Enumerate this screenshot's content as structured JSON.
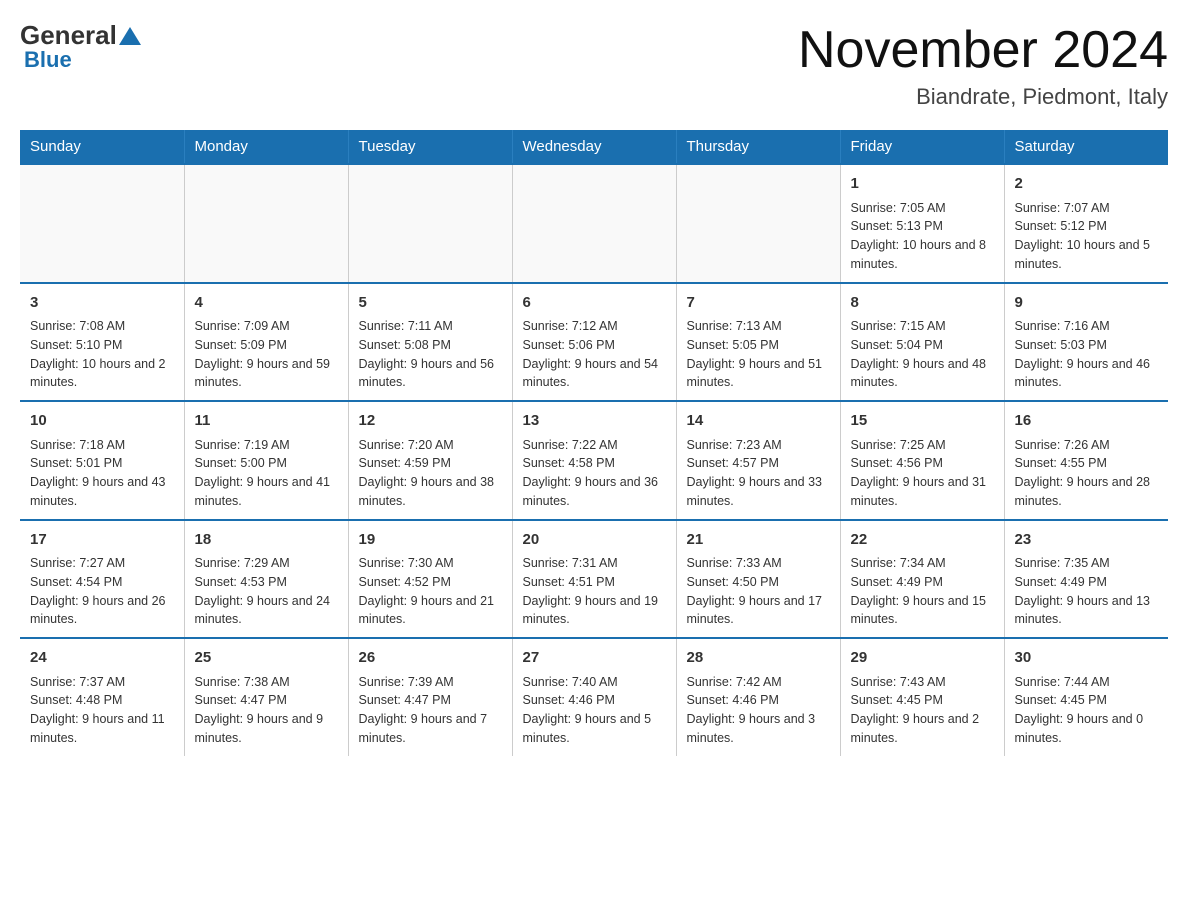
{
  "header": {
    "logo_general": "General",
    "logo_blue": "Blue",
    "month_title": "November 2024",
    "location": "Biandrate, Piedmont, Italy"
  },
  "days_of_week": [
    "Sunday",
    "Monday",
    "Tuesday",
    "Wednesday",
    "Thursday",
    "Friday",
    "Saturday"
  ],
  "weeks": [
    [
      {
        "day": "",
        "info": ""
      },
      {
        "day": "",
        "info": ""
      },
      {
        "day": "",
        "info": ""
      },
      {
        "day": "",
        "info": ""
      },
      {
        "day": "",
        "info": ""
      },
      {
        "day": "1",
        "info": "Sunrise: 7:05 AM\nSunset: 5:13 PM\nDaylight: 10 hours and 8 minutes."
      },
      {
        "day": "2",
        "info": "Sunrise: 7:07 AM\nSunset: 5:12 PM\nDaylight: 10 hours and 5 minutes."
      }
    ],
    [
      {
        "day": "3",
        "info": "Sunrise: 7:08 AM\nSunset: 5:10 PM\nDaylight: 10 hours and 2 minutes."
      },
      {
        "day": "4",
        "info": "Sunrise: 7:09 AM\nSunset: 5:09 PM\nDaylight: 9 hours and 59 minutes."
      },
      {
        "day": "5",
        "info": "Sunrise: 7:11 AM\nSunset: 5:08 PM\nDaylight: 9 hours and 56 minutes."
      },
      {
        "day": "6",
        "info": "Sunrise: 7:12 AM\nSunset: 5:06 PM\nDaylight: 9 hours and 54 minutes."
      },
      {
        "day": "7",
        "info": "Sunrise: 7:13 AM\nSunset: 5:05 PM\nDaylight: 9 hours and 51 minutes."
      },
      {
        "day": "8",
        "info": "Sunrise: 7:15 AM\nSunset: 5:04 PM\nDaylight: 9 hours and 48 minutes."
      },
      {
        "day": "9",
        "info": "Sunrise: 7:16 AM\nSunset: 5:03 PM\nDaylight: 9 hours and 46 minutes."
      }
    ],
    [
      {
        "day": "10",
        "info": "Sunrise: 7:18 AM\nSunset: 5:01 PM\nDaylight: 9 hours and 43 minutes."
      },
      {
        "day": "11",
        "info": "Sunrise: 7:19 AM\nSunset: 5:00 PM\nDaylight: 9 hours and 41 minutes."
      },
      {
        "day": "12",
        "info": "Sunrise: 7:20 AM\nSunset: 4:59 PM\nDaylight: 9 hours and 38 minutes."
      },
      {
        "day": "13",
        "info": "Sunrise: 7:22 AM\nSunset: 4:58 PM\nDaylight: 9 hours and 36 minutes."
      },
      {
        "day": "14",
        "info": "Sunrise: 7:23 AM\nSunset: 4:57 PM\nDaylight: 9 hours and 33 minutes."
      },
      {
        "day": "15",
        "info": "Sunrise: 7:25 AM\nSunset: 4:56 PM\nDaylight: 9 hours and 31 minutes."
      },
      {
        "day": "16",
        "info": "Sunrise: 7:26 AM\nSunset: 4:55 PM\nDaylight: 9 hours and 28 minutes."
      }
    ],
    [
      {
        "day": "17",
        "info": "Sunrise: 7:27 AM\nSunset: 4:54 PM\nDaylight: 9 hours and 26 minutes."
      },
      {
        "day": "18",
        "info": "Sunrise: 7:29 AM\nSunset: 4:53 PM\nDaylight: 9 hours and 24 minutes."
      },
      {
        "day": "19",
        "info": "Sunrise: 7:30 AM\nSunset: 4:52 PM\nDaylight: 9 hours and 21 minutes."
      },
      {
        "day": "20",
        "info": "Sunrise: 7:31 AM\nSunset: 4:51 PM\nDaylight: 9 hours and 19 minutes."
      },
      {
        "day": "21",
        "info": "Sunrise: 7:33 AM\nSunset: 4:50 PM\nDaylight: 9 hours and 17 minutes."
      },
      {
        "day": "22",
        "info": "Sunrise: 7:34 AM\nSunset: 4:49 PM\nDaylight: 9 hours and 15 minutes."
      },
      {
        "day": "23",
        "info": "Sunrise: 7:35 AM\nSunset: 4:49 PM\nDaylight: 9 hours and 13 minutes."
      }
    ],
    [
      {
        "day": "24",
        "info": "Sunrise: 7:37 AM\nSunset: 4:48 PM\nDaylight: 9 hours and 11 minutes."
      },
      {
        "day": "25",
        "info": "Sunrise: 7:38 AM\nSunset: 4:47 PM\nDaylight: 9 hours and 9 minutes."
      },
      {
        "day": "26",
        "info": "Sunrise: 7:39 AM\nSunset: 4:47 PM\nDaylight: 9 hours and 7 minutes."
      },
      {
        "day": "27",
        "info": "Sunrise: 7:40 AM\nSunset: 4:46 PM\nDaylight: 9 hours and 5 minutes."
      },
      {
        "day": "28",
        "info": "Sunrise: 7:42 AM\nSunset: 4:46 PM\nDaylight: 9 hours and 3 minutes."
      },
      {
        "day": "29",
        "info": "Sunrise: 7:43 AM\nSunset: 4:45 PM\nDaylight: 9 hours and 2 minutes."
      },
      {
        "day": "30",
        "info": "Sunrise: 7:44 AM\nSunset: 4:45 PM\nDaylight: 9 hours and 0 minutes."
      }
    ]
  ]
}
